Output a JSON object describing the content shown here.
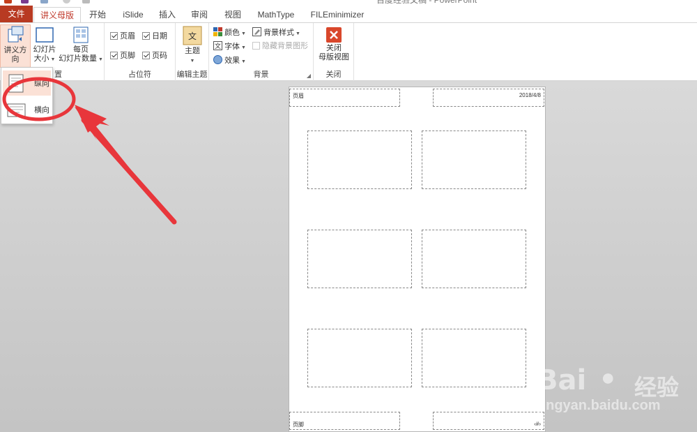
{
  "window": {
    "title": "百度经验文稿 - PowerPoint"
  },
  "tabs": [
    {
      "label": "文件"
    },
    {
      "label": "讲义母版"
    },
    {
      "label": "开始"
    },
    {
      "label": "iSlide"
    },
    {
      "label": "插入"
    },
    {
      "label": "审阅"
    },
    {
      "label": "视图"
    },
    {
      "label": "MathType"
    },
    {
      "label": "FILEminimizer"
    }
  ],
  "ribbon": {
    "page_setup": {
      "orientation_label": "讲义方向",
      "slide_size_line1": "幻灯片",
      "slide_size_line2": "大小",
      "per_page_line1": "每页",
      "per_page_line2": "幻灯片数量",
      "group_label_partial": "置"
    },
    "placeholders": {
      "header": "页眉",
      "date": "日期",
      "footer": "页脚",
      "page_number": "页码",
      "group_label": "占位符",
      "header_checked": true,
      "date_checked": true,
      "footer_checked": true,
      "page_number_checked": true
    },
    "edit_theme": {
      "theme_label": "主题",
      "group_label": "编辑主题"
    },
    "background": {
      "colors": "颜色",
      "fonts": "字体",
      "effects": "效果",
      "bg_styles": "背景样式",
      "hide_bg": "隐藏背景图形",
      "group_label": "背景"
    },
    "close": {
      "line1": "关闭",
      "line2": "母版视图",
      "group_label": "关闭"
    }
  },
  "orientation_menu": {
    "items": [
      {
        "label": "纵向",
        "selected": true
      },
      {
        "label": "横向",
        "selected": false
      }
    ]
  },
  "handout_page": {
    "header_text": "页眉",
    "date_text": "2018/4/8",
    "footer_text": "页脚",
    "page_num_text": "‹#›"
  },
  "watermark": {
    "brand": "Bai",
    "brand2": "经验",
    "url": "jingyan.baidu.com"
  },
  "colors": {
    "accent": "#b83a22",
    "annotation_red": "#e8363b"
  }
}
